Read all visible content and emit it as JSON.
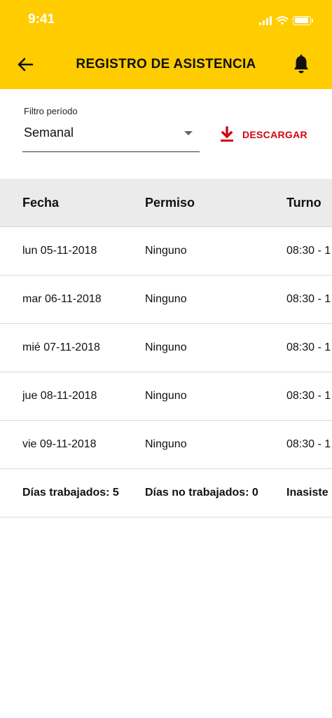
{
  "status_bar": {
    "time": "9:41"
  },
  "header": {
    "title": "REGISTRO DE ASISTENCIA",
    "back_icon": "arrow-left-icon",
    "bell_icon": "bell-icon"
  },
  "filter": {
    "label": "Filtro período",
    "value": "Semanal"
  },
  "download": {
    "label": "DESCARGAR",
    "color": "#D40511"
  },
  "colors": {
    "brand_yellow": "#FFCC00",
    "brand_red": "#D40511"
  },
  "table": {
    "columns": [
      "Fecha",
      "Permiso",
      "Turno"
    ],
    "rows": [
      {
        "fecha": "lun 05-11-2018",
        "permiso": "Ninguno",
        "turno": "08:30 - 1"
      },
      {
        "fecha": "mar 06-11-2018",
        "permiso": "Ninguno",
        "turno": "08:30 - 1"
      },
      {
        "fecha": "mié 07-11-2018",
        "permiso": "Ninguno",
        "turno": "08:30 - 1"
      },
      {
        "fecha": "jue 08-11-2018",
        "permiso": "Ninguno",
        "turno": "08:30 - 1"
      },
      {
        "fecha": "vie 09-11-2018",
        "permiso": "Ninguno",
        "turno": "08:30 - 1"
      }
    ],
    "summary": {
      "trabajados": "Días trabajados: 5",
      "no_trabajados": "Días no trabajados: 0",
      "inasistencias": "Inasiste"
    }
  }
}
